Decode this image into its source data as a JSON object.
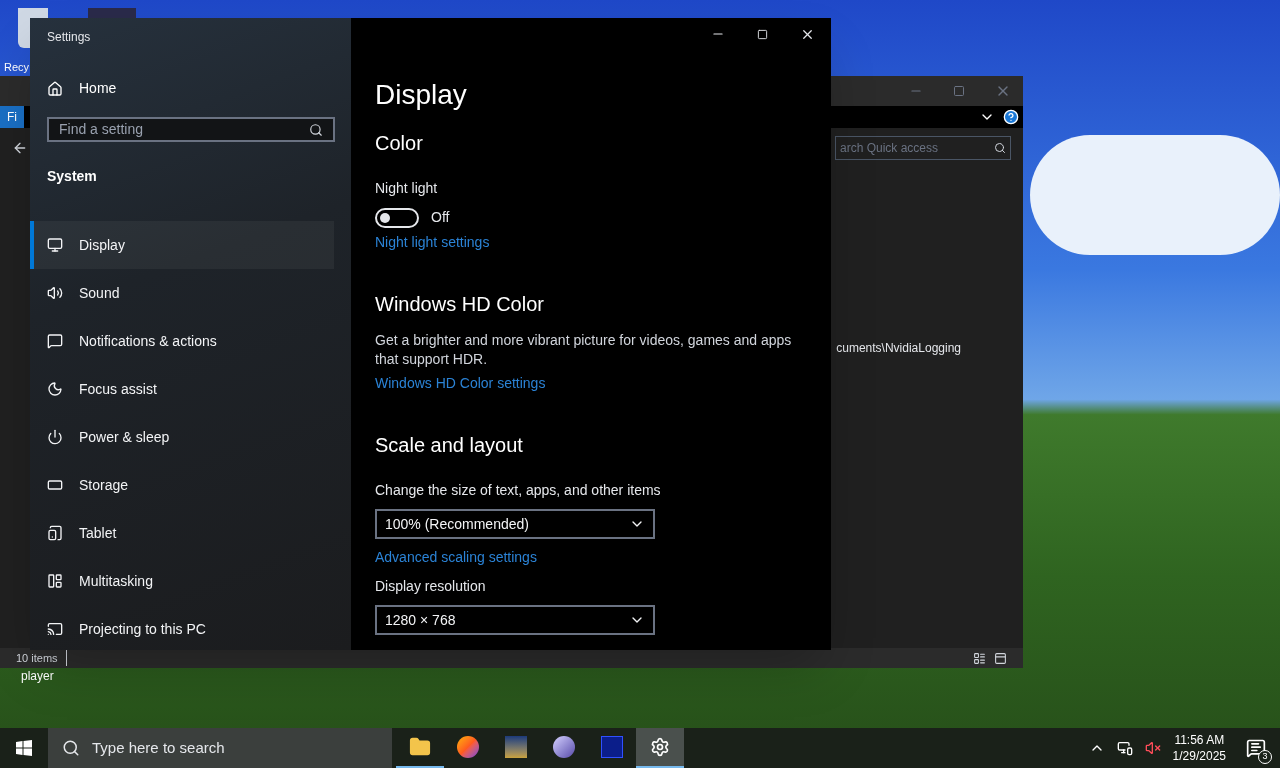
{
  "desktop": {
    "icons": [
      {
        "label": "Recy"
      },
      {
        "label": "player"
      }
    ]
  },
  "explorer": {
    "ribbon_tab": "Fi",
    "search": {
      "placeholder": "arch Quick access"
    },
    "path_text": "cuments\\NvidiaLogging",
    "status": "10 items"
  },
  "settings": {
    "title": "Settings",
    "home": "Home",
    "search": {
      "placeholder": "Find a setting"
    },
    "section": "System",
    "nav": [
      {
        "label": "Display",
        "selected": true
      },
      {
        "label": "Sound",
        "selected": false
      },
      {
        "label": "Notifications & actions",
        "selected": false
      },
      {
        "label": "Focus assist",
        "selected": false
      },
      {
        "label": "Power & sleep",
        "selected": false
      },
      {
        "label": "Storage",
        "selected": false
      },
      {
        "label": "Tablet",
        "selected": false
      },
      {
        "label": "Multitasking",
        "selected": false
      },
      {
        "label": "Projecting to this PC",
        "selected": false
      }
    ],
    "page_title": "Display",
    "content": [
      {
        "kind": "heading",
        "text": "Color"
      },
      {
        "kind": "label",
        "text": "Night light"
      },
      {
        "kind": "toggle",
        "on": false,
        "text": "Off"
      },
      {
        "kind": "link",
        "text": "Night light settings"
      },
      {
        "kind": "heading",
        "text": "Windows HD Color"
      },
      {
        "kind": "paragraph",
        "text": "Get a brighter and more vibrant picture for videos, games and apps that support HDR."
      },
      {
        "kind": "link",
        "text": "Windows HD Color settings"
      },
      {
        "kind": "heading",
        "text": "Scale and layout"
      },
      {
        "kind": "label",
        "text": "Change the size of text, apps, and other items"
      },
      {
        "kind": "dropdown",
        "text": "100% (Recommended)"
      },
      {
        "kind": "link",
        "text": "Advanced scaling settings"
      },
      {
        "kind": "label",
        "text": "Display resolution"
      },
      {
        "kind": "dropdown",
        "text": "1280 × 768"
      }
    ]
  },
  "taskbar": {
    "search_placeholder": "Type here to search",
    "apps": [
      {
        "open": true,
        "selected": false
      },
      {
        "open": false,
        "selected": false
      },
      {
        "open": false,
        "selected": false
      },
      {
        "open": false,
        "selected": false
      },
      {
        "open": false,
        "selected": false
      },
      {
        "open": true,
        "selected": true
      }
    ],
    "time": "11:56 AM",
    "date": "1/29/2025",
    "notification_count": "3"
  }
}
